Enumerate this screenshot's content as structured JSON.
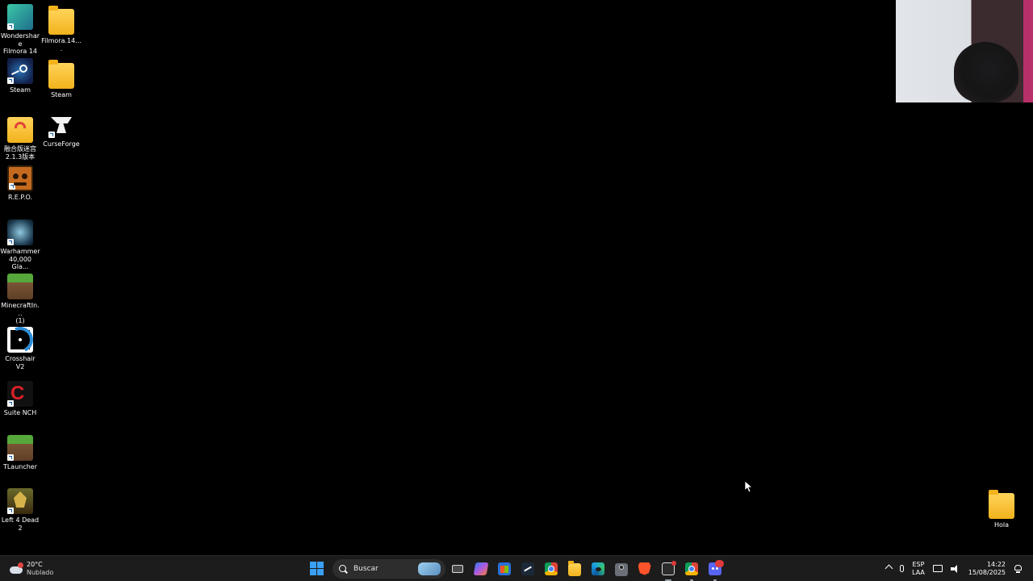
{
  "desktop": {
    "icons": [
      {
        "label": "Wondershare\nFilmora 14",
        "icon": "filmora-icon"
      },
      {
        "label": "Filmora.14....",
        "icon": "folder-icon"
      },
      {
        "label": "Steam",
        "icon": "steam-icon"
      },
      {
        "label": "Steam",
        "icon": "folder-icon"
      },
      {
        "label": "融合版迷宫\n2.1.3版本",
        "icon": "folder-icon"
      },
      {
        "label": "CurseForge",
        "icon": "curseforge-icon"
      },
      {
        "label": "R.E.P.O.",
        "icon": "repo-game-icon"
      },
      {
        "label": "Warhammer\n40,000 Gla...",
        "icon": "warhammer-icon"
      },
      {
        "label": "MinecraftIn...\n(1)",
        "icon": "minecraft-icon"
      },
      {
        "label": "Crosshair V2",
        "icon": "crosshair-icon"
      },
      {
        "label": "Suite NCH",
        "icon": "nch-icon"
      },
      {
        "label": "TLauncher",
        "icon": "minecraft-icon"
      },
      {
        "label": "Left 4 Dead 2",
        "icon": "l4d2-icon"
      },
      {
        "label": "Hola",
        "icon": "folder-icon"
      }
    ]
  },
  "taskbar": {
    "weather": {
      "temp": "20°C",
      "condition": "Nublado"
    },
    "search": {
      "label": "Buscar"
    },
    "apps": [
      {
        "icon": "task-view-icon"
      },
      {
        "icon": "copilot-icon"
      },
      {
        "icon": "microsoft-store-icon"
      },
      {
        "icon": "steam-icon"
      },
      {
        "icon": "chrome-icon"
      },
      {
        "icon": "file-explorer-icon"
      },
      {
        "icon": "edge-icon"
      },
      {
        "icon": "camera-icon"
      },
      {
        "icon": "brave-icon"
      },
      {
        "icon": "obs-icon"
      },
      {
        "icon": "chrome-icon"
      },
      {
        "icon": "discord-icon"
      }
    ],
    "tray": {
      "lang_primary": "ESP",
      "lang_secondary": "LAA",
      "time": "14:22",
      "date": "15/08/2025"
    }
  },
  "colors": {
    "desktop_bg": "#000000",
    "taskbar_bg": "#1c1c1c",
    "accent": "#3aa0f5"
  }
}
